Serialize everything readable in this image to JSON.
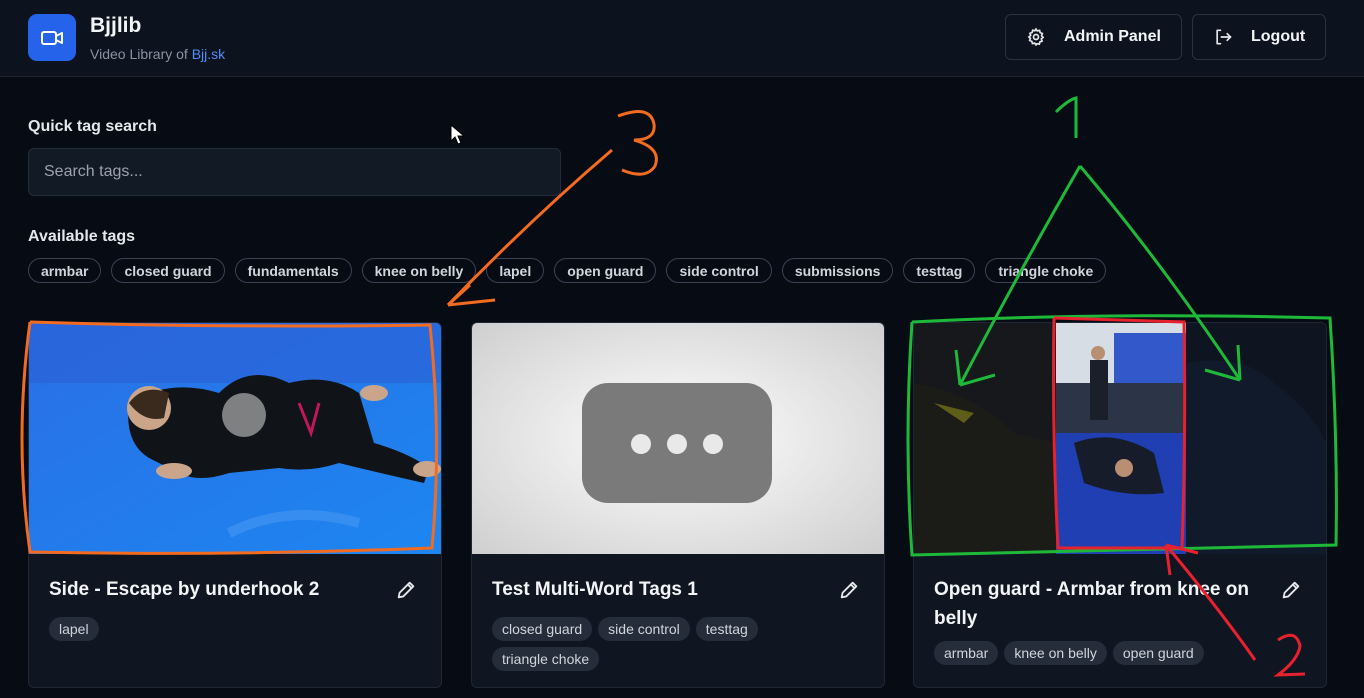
{
  "header": {
    "brand_title": "Bjjlib",
    "brand_sub_prefix": "Video Library of ",
    "brand_link": "Bjj.sk",
    "admin_label": "Admin Panel",
    "logout_label": "Logout"
  },
  "search": {
    "label": "Quick tag search",
    "placeholder": "Search tags..."
  },
  "tags": {
    "label": "Available tags",
    "items": [
      "armbar",
      "closed guard",
      "fundamentals",
      "knee on belly",
      "lapel",
      "open guard",
      "side control",
      "submissions",
      "testtag",
      "triangle choke"
    ]
  },
  "cards": [
    {
      "title": "Side - Escape by underhook 2",
      "tags": [
        "lapel"
      ]
    },
    {
      "title": "Test Multi-Word Tags 1",
      "tags": [
        "closed guard",
        "side control",
        "testtag",
        "triangle choke"
      ]
    },
    {
      "title": "Open guard - Armbar from knee on belly",
      "tags": [
        "armbar",
        "knee on belly",
        "open guard"
      ]
    }
  ],
  "annotations": [
    "3",
    "1",
    "2"
  ],
  "colors": {
    "accent": "#2563eb",
    "link": "#4e8ef7",
    "annotation_orange": "#f26b21",
    "annotation_green": "#1fb93a",
    "annotation_red": "#e8212f"
  }
}
